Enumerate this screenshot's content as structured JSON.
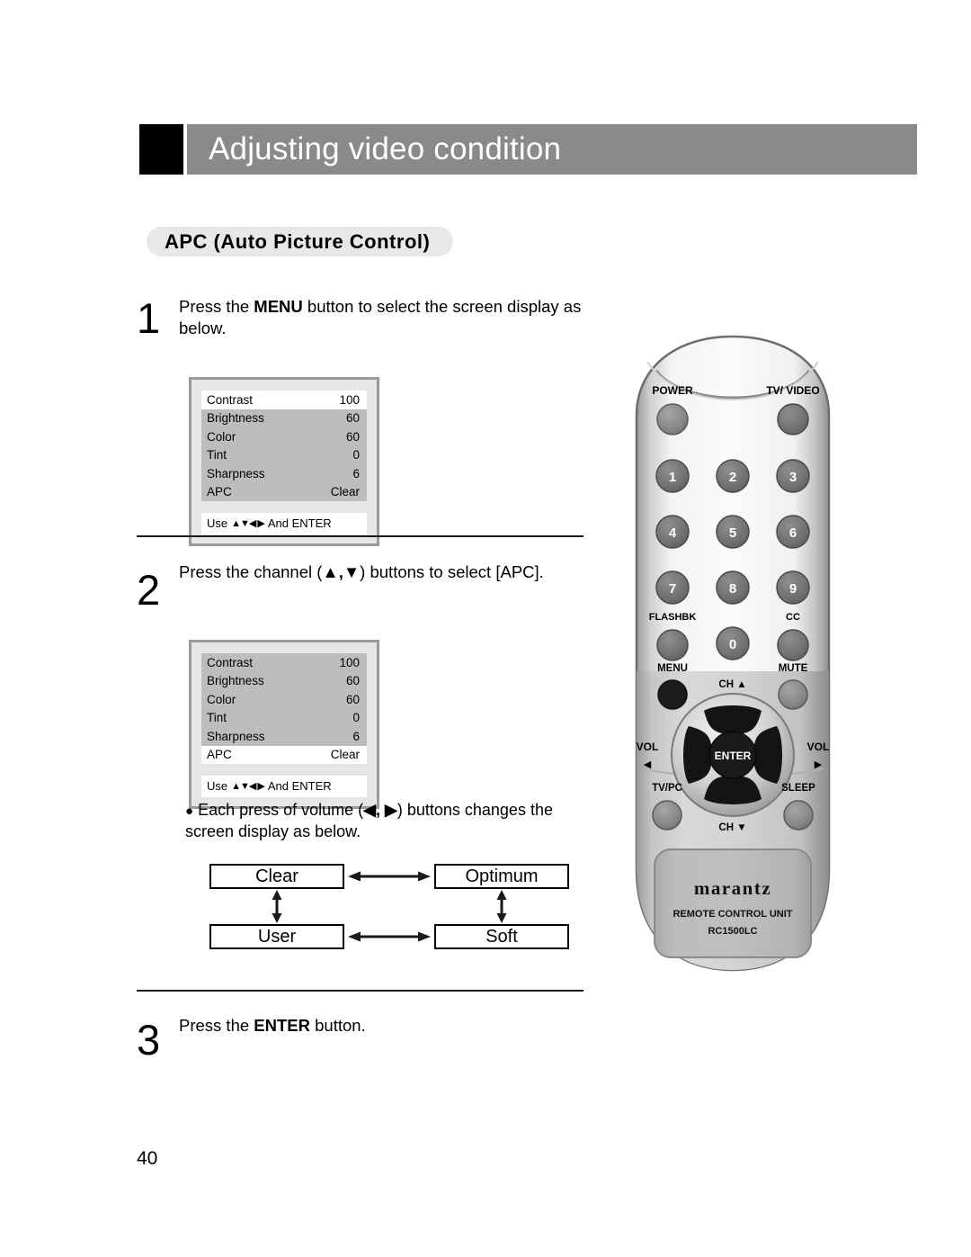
{
  "header": {
    "title": "Adjusting video condition"
  },
  "section": {
    "title": "APC (Auto Picture Control)"
  },
  "steps": [
    {
      "number": "1",
      "text_before": "Press the ",
      "bold": "MENU",
      "text_after": " button to select the screen display as below."
    },
    {
      "number": "2",
      "text_before": "Press the channel (",
      "bold": "▲,▼",
      "text_after": ") buttons to select [APC]."
    },
    {
      "number": "3",
      "text_before": "Press the ",
      "bold": "ENTER",
      "text_after": " button."
    }
  ],
  "osd_menus": [
    {
      "name": "osd-step1",
      "rows": [
        {
          "label": "Contrast",
          "value": "100",
          "selected": true
        },
        {
          "label": "Brightness",
          "value": "60",
          "selected": false
        },
        {
          "label": "Color",
          "value": "60",
          "selected": false
        },
        {
          "label": "Tint",
          "value": "0",
          "selected": false
        },
        {
          "label": "Sharpness",
          "value": "6",
          "selected": false
        },
        {
          "label": "APC",
          "value": "Clear",
          "selected": false
        }
      ],
      "footer_prefix": "Use",
      "footer_arrows": "▲▼◀ ▶",
      "footer_suffix": "And ENTER"
    },
    {
      "name": "osd-step2",
      "rows": [
        {
          "label": "Contrast",
          "value": "100",
          "selected": false
        },
        {
          "label": "Brightness",
          "value": "60",
          "selected": false
        },
        {
          "label": "Color",
          "value": "60",
          "selected": false
        },
        {
          "label": "Tint",
          "value": "0",
          "selected": false
        },
        {
          "label": "Sharpness",
          "value": "6",
          "selected": false
        },
        {
          "label": "APC",
          "value": "Clear",
          "selected": true
        }
      ],
      "footer_prefix": "Use",
      "footer_arrows": "▲▼◀ ▶",
      "footer_suffix": "And ENTER"
    }
  ],
  "bullet_note": {
    "dot": "●",
    "text_before": " Each press of volume (",
    "arrows": "◀, ▶",
    "text_after": ") buttons changes the screen display as below."
  },
  "flow": {
    "clear": "Clear",
    "optimum": "Optimum",
    "user": "User",
    "soft": "Soft"
  },
  "remote": {
    "brand": "marantz",
    "unit_label": "REMOTE CONTROL UNIT",
    "model": "RC1500LC",
    "buttons": {
      "power": "POWER",
      "tv_video": "TV/ VIDEO",
      "flashbk": "FLASHBK",
      "cc": "CC",
      "menu": "MENU",
      "mute": "MUTE",
      "ch_up": "CH ▲",
      "ch_down": "CH ▼",
      "vol_left": "VOL",
      "vol_left_arrow": "◀",
      "vol_right": "VOL",
      "vol_right_arrow": "▶",
      "tv_pc": "TV/PC",
      "sleep": "SLEEP",
      "enter": "ENTER"
    },
    "keypad": [
      "1",
      "2",
      "3",
      "4",
      "5",
      "6",
      "7",
      "8",
      "9",
      "0"
    ]
  },
  "page_number": "40",
  "colors": {
    "header_bar": "#8a8a8a",
    "header_square": "#000000",
    "pill_bg": "#e8e8e8",
    "osd_frame": "#9a9a9a",
    "osd_bg": "#e6e6e6",
    "osd_list_bg": "#bdbdbd",
    "osd_selected_bg": "#ffffff",
    "remote_body": "#d8d8d8",
    "remote_button_dark": "#3a3a3a",
    "remote_button_gray": "#808080"
  }
}
